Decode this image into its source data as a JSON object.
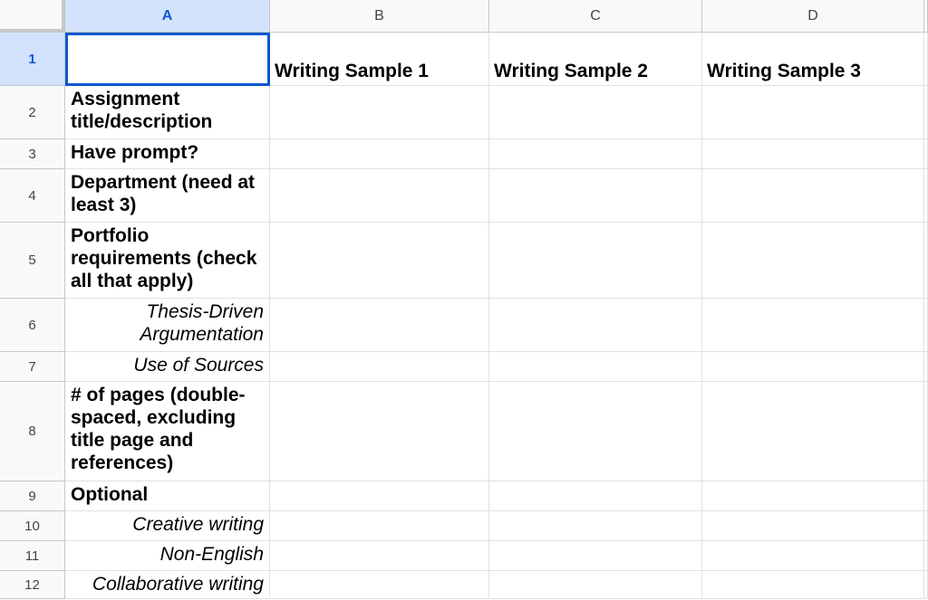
{
  "columns": [
    "A",
    "B",
    "C",
    "D"
  ],
  "rows": [
    {
      "num": "1",
      "a": "",
      "a_style": "none",
      "b": "Writing Sample 1",
      "c": "Writing Sample 2",
      "d": "Writing Sample 3"
    },
    {
      "num": "2",
      "a": "Assignment title/description",
      "a_style": "bold"
    },
    {
      "num": "3",
      "a": "Have prompt?",
      "a_style": "bold"
    },
    {
      "num": "4",
      "a": "Department (need at least 3)",
      "a_style": "bold"
    },
    {
      "num": "5",
      "a": "Portfolio requirements (check all that apply)",
      "a_style": "bold"
    },
    {
      "num": "6",
      "a": "Thesis-Driven Argumentation",
      "a_style": "italic"
    },
    {
      "num": "7",
      "a": "Use of Sources",
      "a_style": "italic"
    },
    {
      "num": "8",
      "a": "# of pages (double-spaced, excluding title page and references)",
      "a_style": "bold"
    },
    {
      "num": "9",
      "a": "Optional",
      "a_style": "bold"
    },
    {
      "num": "10",
      "a": "Creative writing",
      "a_style": "italic"
    },
    {
      "num": "11",
      "a": "Non-English",
      "a_style": "italic"
    },
    {
      "num": "12",
      "a": "Collaborative writing",
      "a_style": "italic"
    }
  ],
  "selected_cell": "A1",
  "colors": {
    "selection": "#0b57d0",
    "header_selected_bg": "#d3e3fd",
    "header_bg": "#f8f9fa",
    "gridline": "#e1e1e1"
  }
}
